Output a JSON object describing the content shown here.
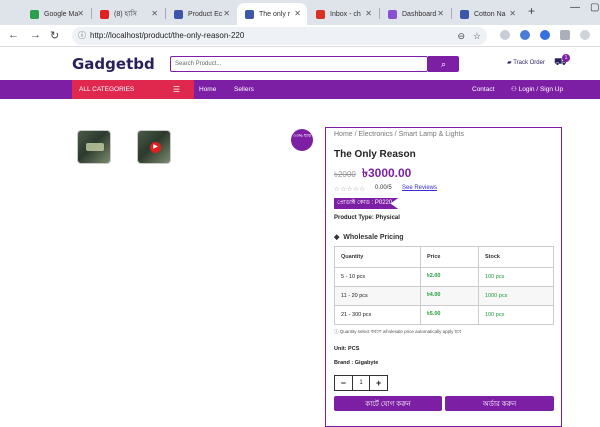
{
  "browser": {
    "tabs": [
      {
        "title": "Google Ma",
        "fav": "#2e9e4f"
      },
      {
        "title": "(8) হাসি",
        "fav": "#e02020"
      },
      {
        "title": "Product Ec",
        "fav": "#3d57a8"
      },
      {
        "title": "The only r",
        "fav": "#3d57a8"
      },
      {
        "title": "Inbox - ch",
        "fav": "#d93025"
      },
      {
        "title": "Dashboard",
        "fav": "#8a4fd0"
      },
      {
        "title": "Cotton Na",
        "fav": "#3d57a8"
      }
    ],
    "url": "http://localhost/product/the-only-reason-220"
  },
  "header": {
    "logo": "Gadgetbd",
    "search_placeholder": "Search Product...",
    "track_order": "Track Order",
    "cart_count": "1"
  },
  "menu": {
    "all_categories": "ALL CATEGORIES",
    "home": "Home",
    "sellers": "Sellers",
    "contact": "Contact",
    "login": "Login / Sign Up"
  },
  "product": {
    "discount_badge": "৩৩% ছাড়",
    "breadcrumb": "Home / Electronics / Smart Lamp & Lights",
    "title": "The Only Reason",
    "old_price": "৳2000",
    "price": "৳3000.00",
    "rating": "0.00/5",
    "see_reviews": "See Reviews",
    "product_code": "প্রোডাক্ট কোড : P0220",
    "product_type": "Product Type: Physical",
    "wholesale_title": "Wholesale Pricing",
    "wholesale_headers": [
      "Quantity",
      "Price",
      "Stock"
    ],
    "wholesale_rows": [
      [
        "5 - 10 pcs",
        "৳2.00",
        "100 pcs"
      ],
      [
        "11 - 20 pcs",
        "৳4.00",
        "1000 pcs"
      ],
      [
        "21 - 300 pcs",
        "৳5.00",
        "100 pcs"
      ]
    ],
    "wholesale_note": "Quantity select করলে wholesale price automatically apply হবে",
    "unit": "Unit: PCS",
    "brand": "Brand : Gigabyte",
    "quantity": "1",
    "add_to_cart": "কার্টে যোগ করুন",
    "order_now": "অর্ডার করুন"
  }
}
